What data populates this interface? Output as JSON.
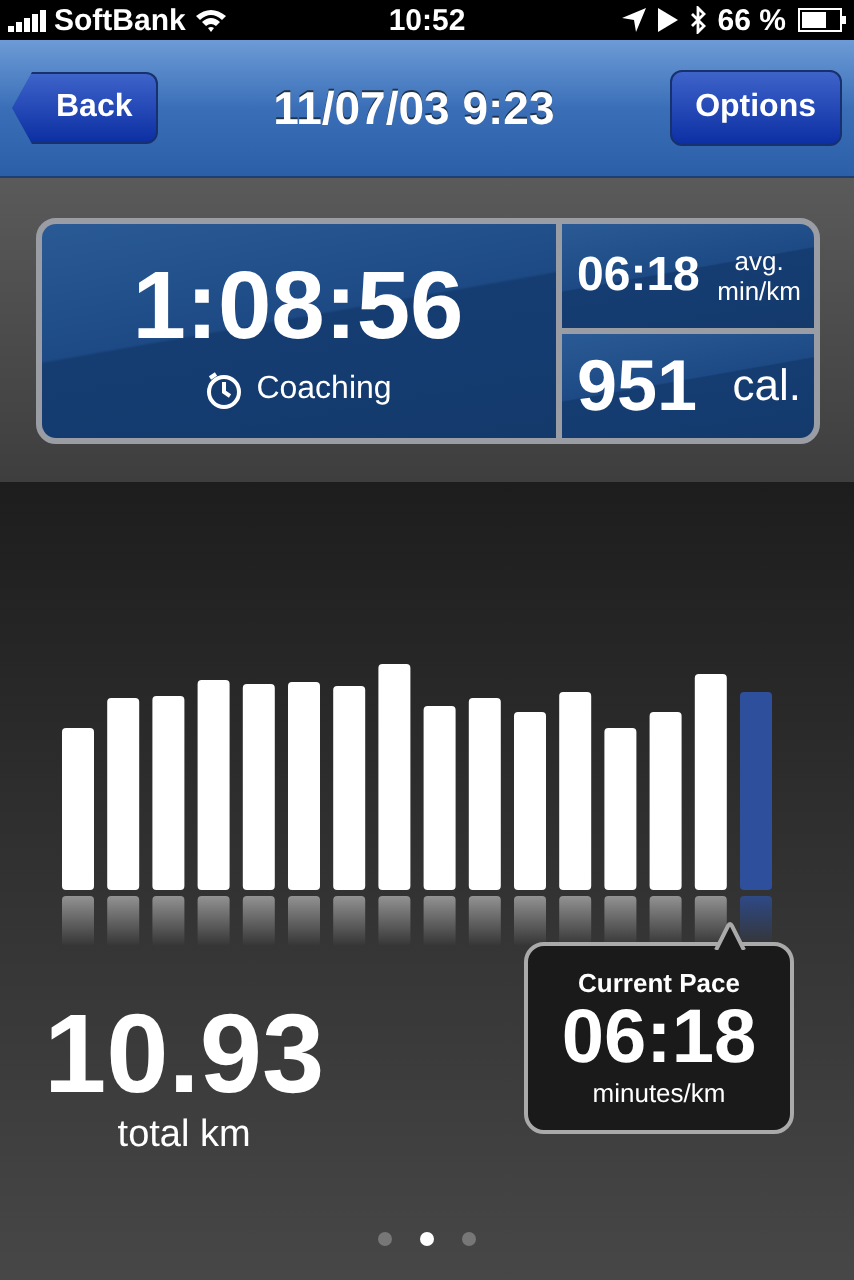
{
  "status_bar": {
    "carrier": "SoftBank",
    "time": "10:52",
    "battery": "66 %"
  },
  "nav_bar": {
    "back": "Back",
    "title": "11/07/03 9:23",
    "options": "Options"
  },
  "summary": {
    "duration": "1:08:56",
    "coaching": "Coaching",
    "pace": "06:18",
    "pace_unit_1": "avg.",
    "pace_unit_2": "min/km",
    "calories": "951",
    "calories_unit": "cal."
  },
  "distance": {
    "value": "10.93",
    "unit": "total km"
  },
  "current_pace": {
    "label": "Current Pace",
    "value": "06:18",
    "unit": "minutes/km"
  },
  "pages": [
    {
      "selected": false
    },
    {
      "selected": true
    },
    {
      "selected": false
    }
  ]
}
